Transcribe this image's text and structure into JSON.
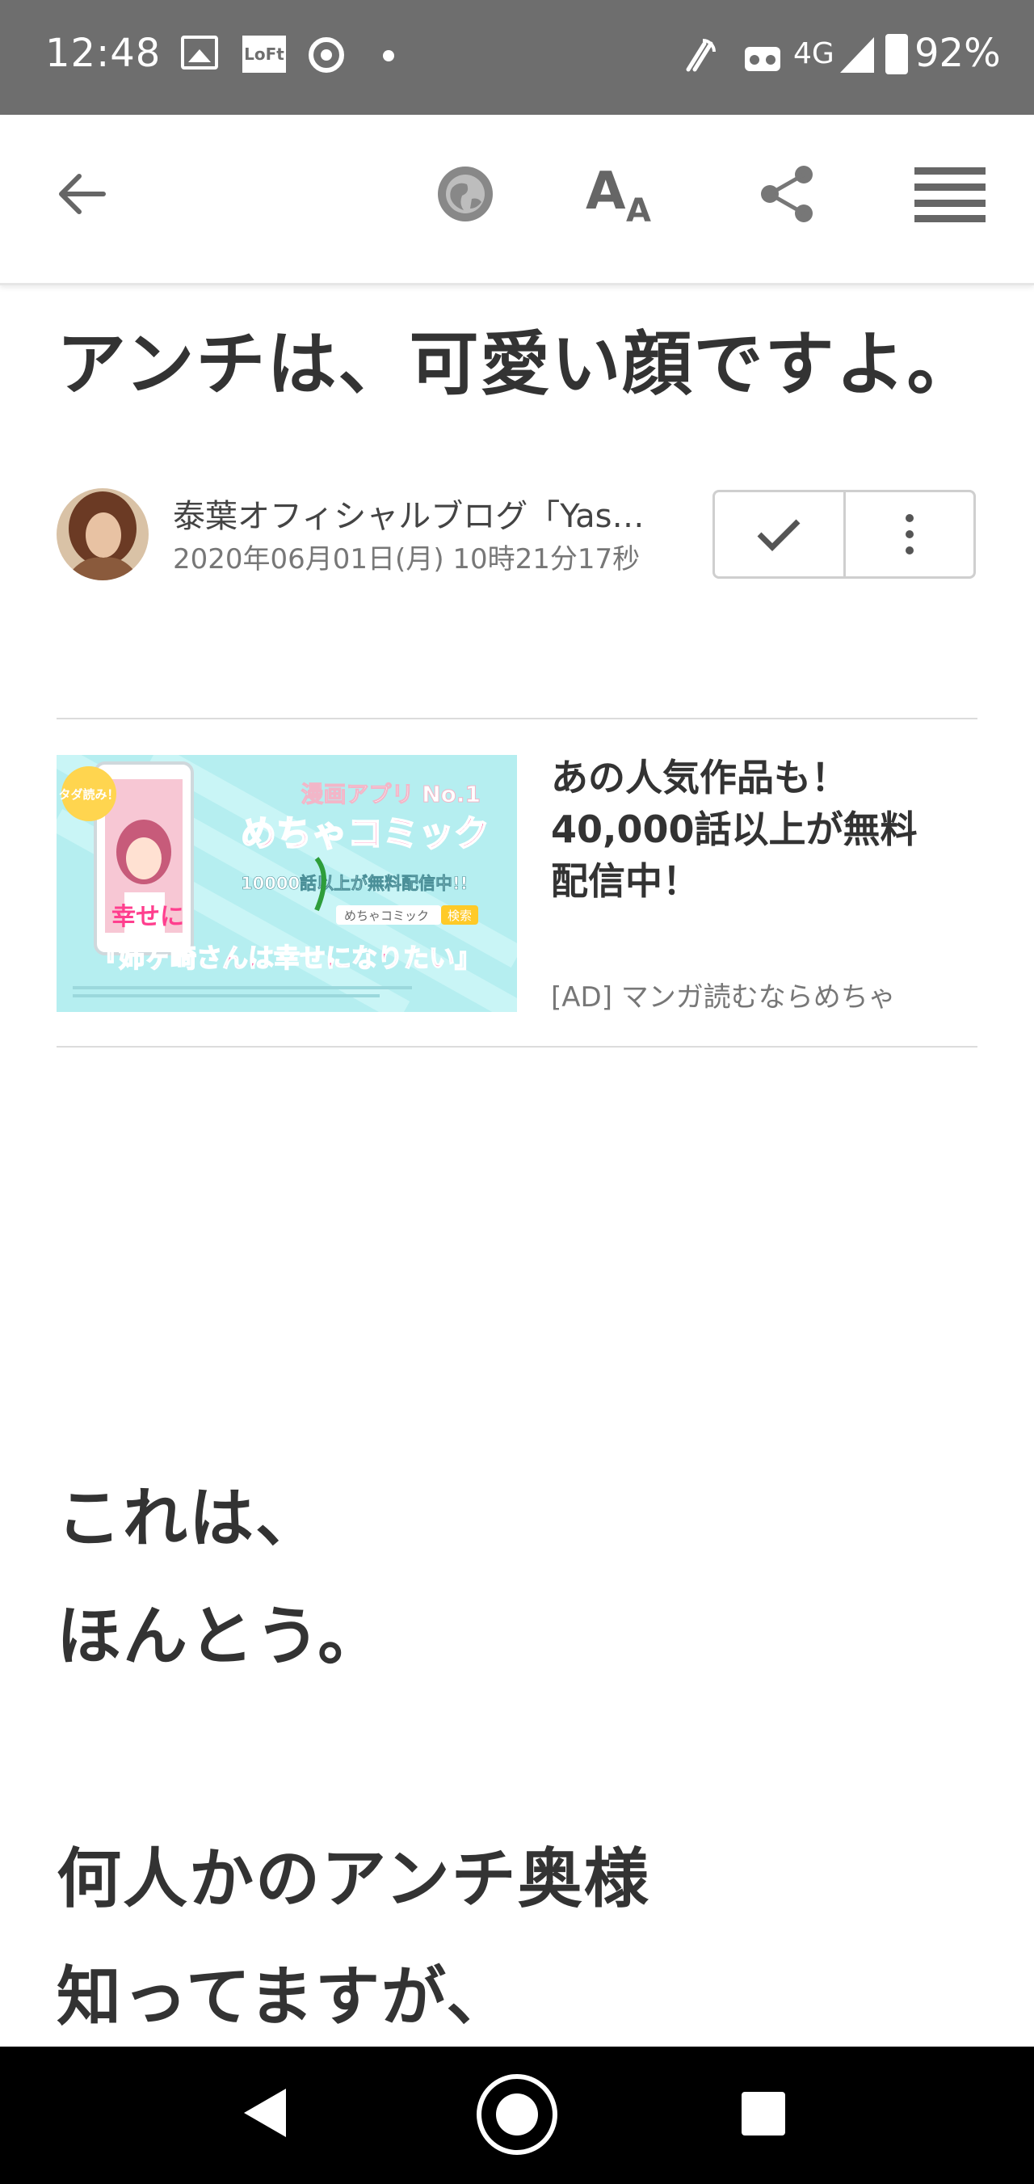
{
  "status_bar": {
    "time": "12:48",
    "loft_label": "LoFt",
    "network": "4G",
    "battery": "92%"
  },
  "toolbar": {
    "icons": [
      "back-arrow-icon",
      "globe-icon",
      "text-size-icon",
      "share-icon",
      "menu-icon"
    ]
  },
  "article": {
    "title": "アンチは、可愛い顔ですよ。",
    "author": "泰葉オフィシャルブログ「Yas…",
    "date": "2020年06月01日(月) 10時21分17秒"
  },
  "ad": {
    "title_lines": [
      "あの人気作品も！",
      "40,000話以上が無料",
      "配信中！"
    ],
    "label": "[AD]  マンガ読むならめちゃ",
    "image": {
      "badge": "タダ読み！",
      "headline": "漫画アプリ No.1",
      "brand": "めちゃコミック",
      "count": "10000話以上が無料配信中!!",
      "search_box": "めちゃコミック",
      "search_btn": "検索",
      "book_title": "『姉ヶ崎さんは幸せになりたい』",
      "vertical_text": "幸せに"
    }
  },
  "body": {
    "lines": [
      "これは、",
      "ほんとう。",
      "何人かのアンチ奥様",
      "知ってますが、"
    ]
  },
  "colors": {
    "status_bar": "#6e6e6e",
    "ad_background": "#b5eef0",
    "ad_brand_pink": "#ff3f8e",
    "nav_bar": "#000000"
  }
}
